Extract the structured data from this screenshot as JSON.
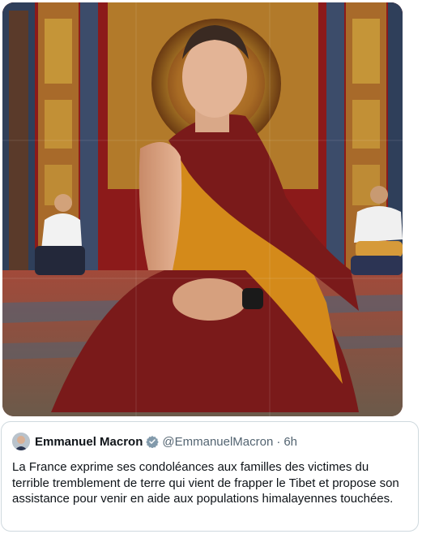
{
  "tweet": {
    "display_name": "Emmanuel Macron",
    "handle": "@EmmanuelMacron",
    "separator": "·",
    "time": "6h",
    "text": "La France exprime ses condoléances aux familles des victimes du terrible tremblement de terre qui vient de frapper le Tibet et propose son assistance pour venir en aide aux populations himalayennes touchées."
  },
  "colors": {
    "verified_badge": "#829aab",
    "robe_maroon": "#7a1a1a",
    "robe_saffron": "#d48a1a",
    "text_primary": "#0f1419",
    "text_secondary": "#536471",
    "card_border": "#cfd9de"
  },
  "icons": {
    "verified": "verified-badge-icon"
  }
}
